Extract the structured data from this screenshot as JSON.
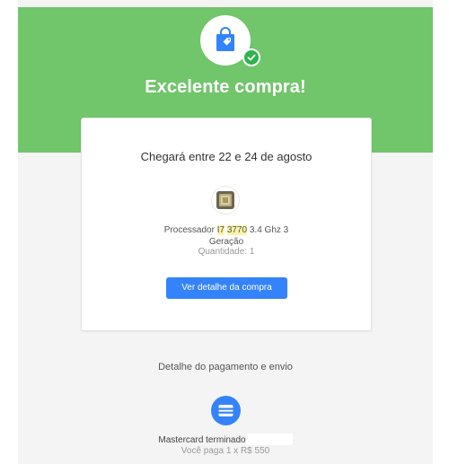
{
  "hero": {
    "title": "Excelente compra!",
    "background_color": "#71c56b",
    "icon": "shopping-bag-icon",
    "badge_icon": "check-icon"
  },
  "order": {
    "arrival_text": "Chegará entre 22 e 24 de agosto",
    "product": {
      "image_icon": "processor-chip-icon",
      "name_prefix": "Processador ",
      "name_highlight_1": "I7",
      "name_space": " ",
      "name_highlight_2": "3770",
      "name_suffix": " 3.4 Ghz 3 Geração",
      "quantity": "Quantidade: 1"
    },
    "button_label": "Ver detalhe da compra"
  },
  "payment": {
    "section_title": "Detalhe do pagamento e envio",
    "method_icon": "credit-card-icon",
    "method_text": "Mastercard terminado",
    "amount_text": "Você paga 1 x R$ 550"
  },
  "colors": {
    "accent": "#3483fa",
    "success": "#2fb34d"
  }
}
